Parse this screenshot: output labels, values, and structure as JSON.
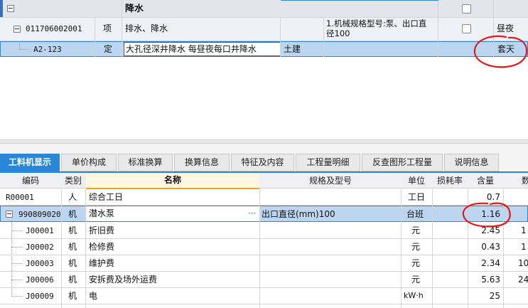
{
  "upper_table": {
    "rows": [
      {
        "type": "section",
        "name": "降水"
      },
      {
        "code": "011706002001",
        "category": "项",
        "name": "排水、降水",
        "feature_line1": "1.机械规格型号:泵、出口直",
        "feature_line2": "径100",
        "unit_partial": "昼夜"
      },
      {
        "code": "A2-123",
        "category": "定",
        "name": "大孔径深井降水 每昼夜每口井降水",
        "specialty": "土建",
        "unit_partial": "套天"
      }
    ]
  },
  "tabs": [
    "工料机显示",
    "单价构成",
    "标准换算",
    "换算信息",
    "特征及内容",
    "工程量明细",
    "反查图形工程量",
    "说明信息"
  ],
  "lower_table": {
    "headers": {
      "code": "编码",
      "category": "类别",
      "name": "名称",
      "spec": "规格及型号",
      "unit": "单位",
      "loss": "损耗率",
      "content": "含量",
      "qty_partial": "数"
    },
    "rows": [
      {
        "code": "R00001",
        "category": "人",
        "name": "综合工日",
        "spec": "",
        "unit": "工日",
        "content": "0.7",
        "qty": ""
      },
      {
        "code": "990809020",
        "category": "机",
        "name": "潜水泵",
        "spec": "出口直径(mm)100",
        "unit": "台班",
        "content": "1.16",
        "qty": ""
      },
      {
        "code": "J00001",
        "category": "机",
        "name": "折旧费",
        "spec": "",
        "unit": "元",
        "content": "2.45",
        "qty": "1"
      },
      {
        "code": "J00002",
        "category": "机",
        "name": "检修费",
        "spec": "",
        "unit": "元",
        "content": "0.43",
        "qty": "1"
      },
      {
        "code": "J00003",
        "category": "机",
        "name": "维护费",
        "spec": "",
        "unit": "元",
        "content": "2.34",
        "qty": "10"
      },
      {
        "code": "J00006",
        "category": "机",
        "name": "安拆费及场外运费",
        "spec": "",
        "unit": "元",
        "content": "5.63",
        "qty": "24"
      },
      {
        "code": "J00009",
        "category": "机",
        "name": "电",
        "spec": "",
        "unit": "kW·h",
        "content": "25",
        "qty": ""
      }
    ],
    "ellipsis": "···"
  },
  "colors": {
    "accent": "#2a86d6",
    "selected_row": "#bcd6f2",
    "annotation": "#e01a1a"
  }
}
